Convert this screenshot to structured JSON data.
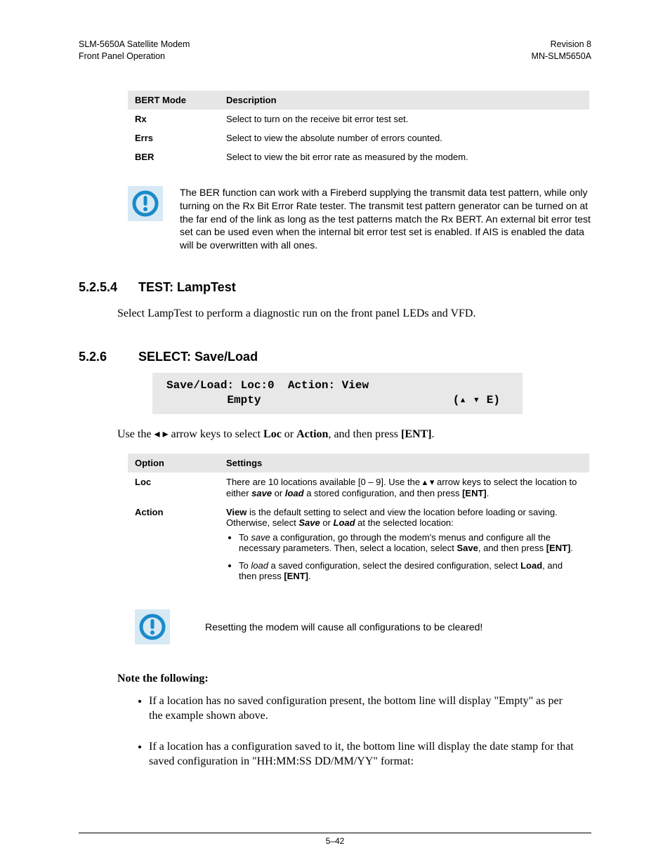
{
  "header": {
    "left1": "SLM-5650A Satellite Modem",
    "left2": "Front Panel Operation",
    "right1": "Revision 8",
    "right2": "MN-SLM5650A"
  },
  "table1": {
    "head_col1": "BERT Mode",
    "head_col2": "Description",
    "rows": [
      {
        "mode": "Rx",
        "desc": "Select to turn on the receive bit error test set."
      },
      {
        "mode": "Errs",
        "desc": "Select to view the absolute number of errors counted."
      },
      {
        "mode": "BER",
        "desc": "Select to view the bit error rate as measured by the modem."
      }
    ]
  },
  "note1": "The BER function can work with a Fireberd supplying the transmit data test pattern, while only turning on the Rx Bit Error Rate tester. The transmit test pattern generator can be turned on at the far end of the link as long as the test patterns match the Rx BERT. An external bit error test set can be used even when the internal bit error test set is enabled. If AIS is enabled the data will be overwritten with all ones.",
  "sec1": {
    "num": "5.2.5.4",
    "title": "TEST: LampTest"
  },
  "sec1_body": "Select LampTest to perform a diagnostic run on the front panel LEDs and VFD.",
  "sec2": {
    "num": "5.2.6",
    "title": "SELECT: Save/Load"
  },
  "lcd": {
    "line1": "Save/Load: Loc:0  Action: View",
    "line2a": "         Empty",
    "line2b_suffix": "E)"
  },
  "sec2_instr": {
    "pre": "Use the ",
    "mid": " arrow keys to select ",
    "loc": "Loc",
    "or": " or ",
    "action": "Action",
    "post": ", and then press ",
    "ent": "[ENT]",
    "end": "."
  },
  "table2": {
    "head_col1": "Option",
    "head_col2": "Settings",
    "loc_label": "Loc",
    "loc_pre": "There are 10 locations available [0 – 9]. Use the ",
    "loc_mid": " arrow keys to select the location to either ",
    "loc_save": "save",
    "loc_or": " or ",
    "loc_load": "load",
    "loc_post": " a stored configuration, and then press ",
    "loc_ent": "[ENT]",
    "loc_end": ".",
    "act_label": "Action",
    "act_p1a": "View",
    "act_p1b": " is the default setting to select and view the location before loading or saving. Otherwise, select ",
    "act_p1c": "Save",
    "act_p1d": " or ",
    "act_p1e": "Load",
    "act_p1f": " at the selected location:",
    "act_li1a": "To ",
    "act_li1b": "save",
    "act_li1c": " a configuration, go through the modem's menus and configure all the necessary parameters. Then, select a location, select ",
    "act_li1d": "Save",
    "act_li1e": ", and then press ",
    "act_li1f": "[ENT]",
    "act_li1g": ".",
    "act_li2a": "To ",
    "act_li2b": "load",
    "act_li2c": " a saved configuration, select the desired configuration, select ",
    "act_li2d": "Load",
    "act_li2e": ", and then press ",
    "act_li2f": "[ENT]",
    "act_li2g": "."
  },
  "note2": "Resetting the modem will cause all configurations to be cleared!",
  "subhead": "Note the following:",
  "body_list": [
    "If a location has no saved configuration present, the bottom line will display \"Empty\" as per the example shown above.",
    "If a location has a configuration saved to it, the bottom line will display the date stamp for that saved configuration in \"HH:MM:SS DD/MM/YY\" format:"
  ],
  "footer": "5–42"
}
